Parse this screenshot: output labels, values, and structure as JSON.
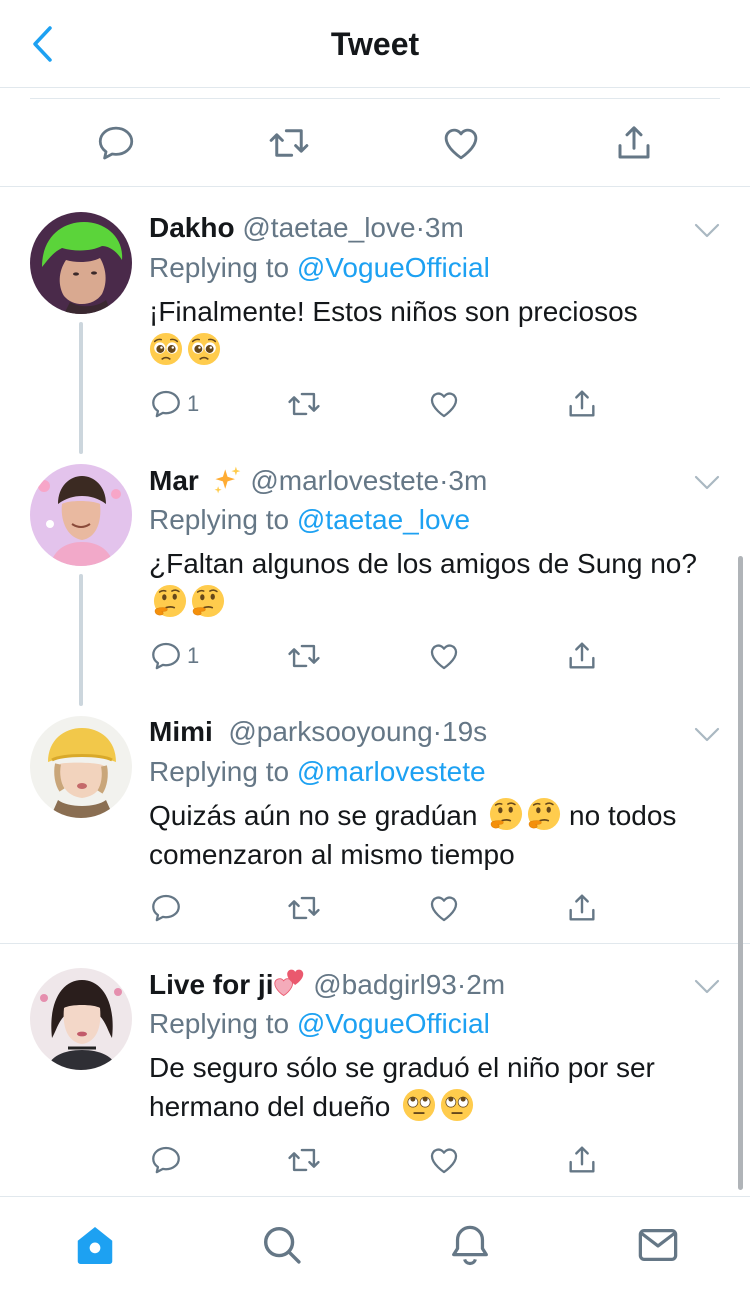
{
  "header": {
    "title": "Tweet"
  },
  "colors": {
    "accent": "#1da1f2",
    "secondary": "#657786",
    "icon": "#657786",
    "divider": "#e1e8ed"
  },
  "main_actions": [
    "reply-icon",
    "retweet-icon",
    "like-icon",
    "share-icon"
  ],
  "tweets": [
    {
      "name": "Dakho",
      "handle": "@taetae_love",
      "dot": "·",
      "time": "3m",
      "replying_prefix": "Replying to",
      "replying_to": "@VogueOfficial",
      "text": "¡Finalmente! Estos niños son preciosos",
      "emojis": [
        "pleading-face",
        "pleading-face"
      ],
      "reply_count": "1"
    },
    {
      "name": "Mar",
      "name_emoji": "sparkles",
      "handle": "@marlovestete",
      "dot": "·",
      "time": "3m",
      "replying_prefix": "Replying to",
      "replying_to": "@taetae_love",
      "text": "¿Faltan algunos de los amigos de Sung no?",
      "emojis": [
        "thinking-face",
        "thinking-face"
      ],
      "reply_count": "1"
    },
    {
      "name": "Mimi",
      "handle": "@parksooyoung",
      "dot": "·",
      "time": "19s",
      "replying_prefix": "Replying to",
      "replying_to": "@marlovestete",
      "text_before": "Quizás aún no se gradúan",
      "emojis": [
        "thinking-face",
        "thinking-face"
      ],
      "text_after": "no todos comenzaron al mismo tiempo",
      "reply_count": ""
    },
    {
      "name": "Live for ji",
      "name_emoji": "two-hearts",
      "handle": "@badgirl93",
      "dot": "·",
      "time": "2m",
      "replying_prefix": "Replying to",
      "replying_to": "@VogueOfficial",
      "text": "De seguro sólo se graduó el niño por ser hermano del dueño",
      "emojis": [
        "eye-roll-face",
        "eye-roll-face"
      ],
      "reply_count": ""
    }
  ],
  "tabbar": [
    "home-icon",
    "search-icon",
    "notifications-icon",
    "messages-icon"
  ]
}
